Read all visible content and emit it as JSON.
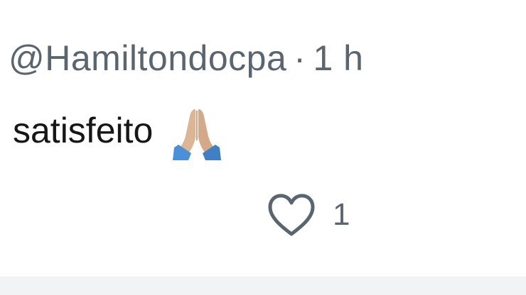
{
  "comment": {
    "username": "@Hamiltondocpa",
    "separator": "·",
    "timestamp": "1 h",
    "text": "satisfeito",
    "emoji_icon": "folded-hands-icon",
    "like_icon": "heart-outline-icon",
    "like_count": "1"
  },
  "colors": {
    "meta_text": "#5b6570",
    "body_text": "#161616",
    "icon_stroke": "#5b6570",
    "emoji_skin": "#dcb596",
    "emoji_sleeve": "#4a90d9",
    "background": "#ffffff"
  }
}
